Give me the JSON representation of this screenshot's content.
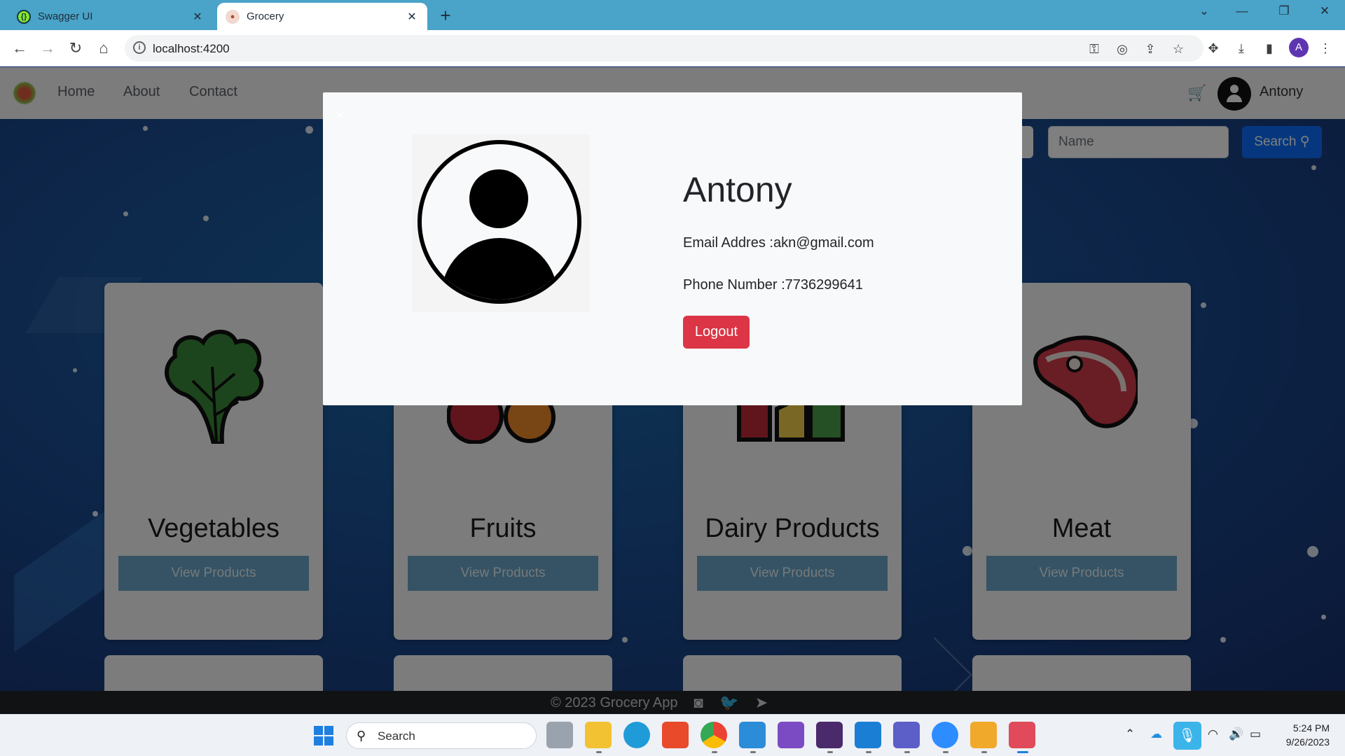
{
  "browser": {
    "tabs": [
      {
        "title": "Swagger UI",
        "active": false
      },
      {
        "title": "Grocery",
        "active": true
      }
    ],
    "url": "localhost:4200",
    "profile_initial": "A"
  },
  "app": {
    "nav": {
      "links": [
        "Home",
        "About",
        "Contact"
      ],
      "username": "Antony"
    },
    "search": {
      "placeholder": "Name",
      "button_label": "Search"
    },
    "categories": [
      {
        "title": "Vegetables",
        "button": "View Products",
        "icon": "vegetable-icon"
      },
      {
        "title": "Fruits",
        "button": "View Products",
        "icon": "fruit-icon"
      },
      {
        "title": "Dairy Products",
        "button": "View Products",
        "icon": "dairy-icon"
      },
      {
        "title": "Meat",
        "button": "View Products",
        "icon": "meat-icon"
      }
    ],
    "footer": {
      "text": "© 2023 Grocery App",
      "social": [
        "instagram-icon",
        "twitter-icon",
        "telegram-icon"
      ]
    }
  },
  "modal": {
    "close_label": "×",
    "name": "Antony",
    "email_line": "Email Addres :akn@gmail.com",
    "phone_line": "Phone Number :7736299641",
    "logout_label": "Logout"
  },
  "taskbar": {
    "search_label": "Search",
    "time": "5:24 PM",
    "date": "9/26/2023"
  },
  "colors": {
    "tabbar": "#4aa3c8",
    "search_button": "#0d6efd",
    "logout_button": "#dc3545",
    "card_button": "#6aa7c9"
  }
}
